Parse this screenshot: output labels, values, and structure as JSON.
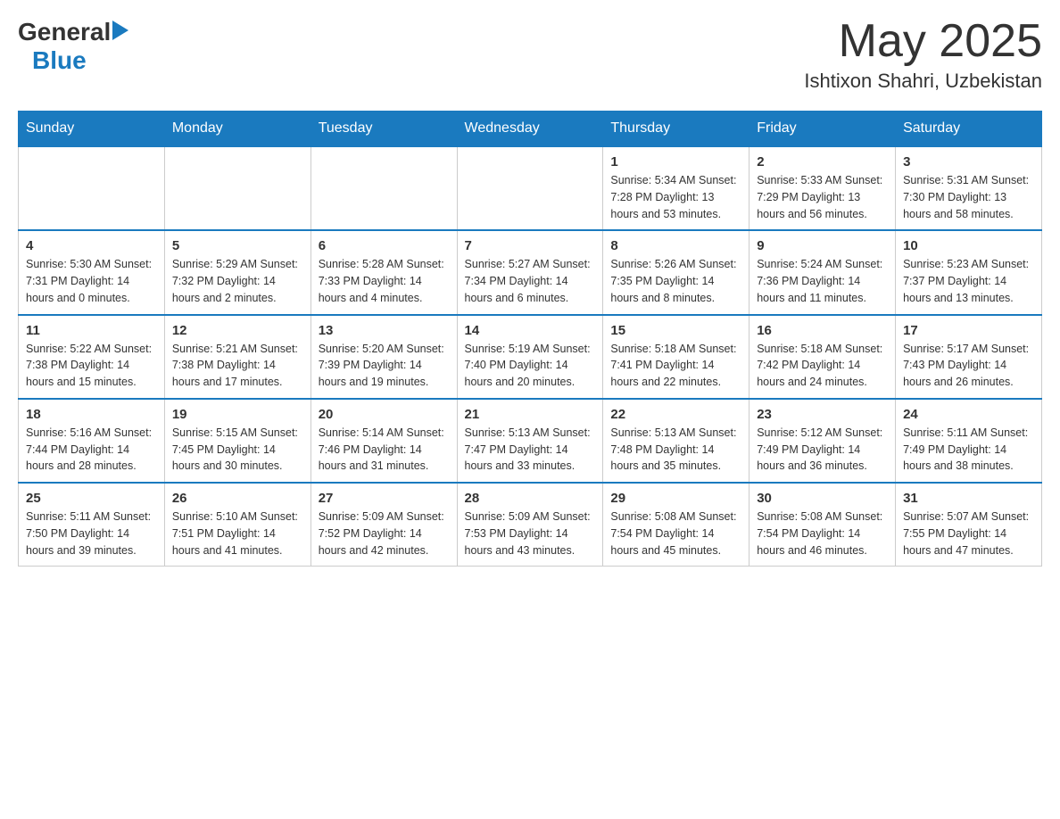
{
  "logo": {
    "general": "General",
    "blue": "Blue",
    "triangle": "▶"
  },
  "title": {
    "month": "May 2025",
    "location": "Ishtixon Shahri, Uzbekistan"
  },
  "weekdays": [
    "Sunday",
    "Monday",
    "Tuesday",
    "Wednesday",
    "Thursday",
    "Friday",
    "Saturday"
  ],
  "weeks": [
    [
      {
        "day": "",
        "info": ""
      },
      {
        "day": "",
        "info": ""
      },
      {
        "day": "",
        "info": ""
      },
      {
        "day": "",
        "info": ""
      },
      {
        "day": "1",
        "info": "Sunrise: 5:34 AM\nSunset: 7:28 PM\nDaylight: 13 hours\nand 53 minutes."
      },
      {
        "day": "2",
        "info": "Sunrise: 5:33 AM\nSunset: 7:29 PM\nDaylight: 13 hours\nand 56 minutes."
      },
      {
        "day": "3",
        "info": "Sunrise: 5:31 AM\nSunset: 7:30 PM\nDaylight: 13 hours\nand 58 minutes."
      }
    ],
    [
      {
        "day": "4",
        "info": "Sunrise: 5:30 AM\nSunset: 7:31 PM\nDaylight: 14 hours\nand 0 minutes."
      },
      {
        "day": "5",
        "info": "Sunrise: 5:29 AM\nSunset: 7:32 PM\nDaylight: 14 hours\nand 2 minutes."
      },
      {
        "day": "6",
        "info": "Sunrise: 5:28 AM\nSunset: 7:33 PM\nDaylight: 14 hours\nand 4 minutes."
      },
      {
        "day": "7",
        "info": "Sunrise: 5:27 AM\nSunset: 7:34 PM\nDaylight: 14 hours\nand 6 minutes."
      },
      {
        "day": "8",
        "info": "Sunrise: 5:26 AM\nSunset: 7:35 PM\nDaylight: 14 hours\nand 8 minutes."
      },
      {
        "day": "9",
        "info": "Sunrise: 5:24 AM\nSunset: 7:36 PM\nDaylight: 14 hours\nand 11 minutes."
      },
      {
        "day": "10",
        "info": "Sunrise: 5:23 AM\nSunset: 7:37 PM\nDaylight: 14 hours\nand 13 minutes."
      }
    ],
    [
      {
        "day": "11",
        "info": "Sunrise: 5:22 AM\nSunset: 7:38 PM\nDaylight: 14 hours\nand 15 minutes."
      },
      {
        "day": "12",
        "info": "Sunrise: 5:21 AM\nSunset: 7:38 PM\nDaylight: 14 hours\nand 17 minutes."
      },
      {
        "day": "13",
        "info": "Sunrise: 5:20 AM\nSunset: 7:39 PM\nDaylight: 14 hours\nand 19 minutes."
      },
      {
        "day": "14",
        "info": "Sunrise: 5:19 AM\nSunset: 7:40 PM\nDaylight: 14 hours\nand 20 minutes."
      },
      {
        "day": "15",
        "info": "Sunrise: 5:18 AM\nSunset: 7:41 PM\nDaylight: 14 hours\nand 22 minutes."
      },
      {
        "day": "16",
        "info": "Sunrise: 5:18 AM\nSunset: 7:42 PM\nDaylight: 14 hours\nand 24 minutes."
      },
      {
        "day": "17",
        "info": "Sunrise: 5:17 AM\nSunset: 7:43 PM\nDaylight: 14 hours\nand 26 minutes."
      }
    ],
    [
      {
        "day": "18",
        "info": "Sunrise: 5:16 AM\nSunset: 7:44 PM\nDaylight: 14 hours\nand 28 minutes."
      },
      {
        "day": "19",
        "info": "Sunrise: 5:15 AM\nSunset: 7:45 PM\nDaylight: 14 hours\nand 30 minutes."
      },
      {
        "day": "20",
        "info": "Sunrise: 5:14 AM\nSunset: 7:46 PM\nDaylight: 14 hours\nand 31 minutes."
      },
      {
        "day": "21",
        "info": "Sunrise: 5:13 AM\nSunset: 7:47 PM\nDaylight: 14 hours\nand 33 minutes."
      },
      {
        "day": "22",
        "info": "Sunrise: 5:13 AM\nSunset: 7:48 PM\nDaylight: 14 hours\nand 35 minutes."
      },
      {
        "day": "23",
        "info": "Sunrise: 5:12 AM\nSunset: 7:49 PM\nDaylight: 14 hours\nand 36 minutes."
      },
      {
        "day": "24",
        "info": "Sunrise: 5:11 AM\nSunset: 7:49 PM\nDaylight: 14 hours\nand 38 minutes."
      }
    ],
    [
      {
        "day": "25",
        "info": "Sunrise: 5:11 AM\nSunset: 7:50 PM\nDaylight: 14 hours\nand 39 minutes."
      },
      {
        "day": "26",
        "info": "Sunrise: 5:10 AM\nSunset: 7:51 PM\nDaylight: 14 hours\nand 41 minutes."
      },
      {
        "day": "27",
        "info": "Sunrise: 5:09 AM\nSunset: 7:52 PM\nDaylight: 14 hours\nand 42 minutes."
      },
      {
        "day": "28",
        "info": "Sunrise: 5:09 AM\nSunset: 7:53 PM\nDaylight: 14 hours\nand 43 minutes."
      },
      {
        "day": "29",
        "info": "Sunrise: 5:08 AM\nSunset: 7:54 PM\nDaylight: 14 hours\nand 45 minutes."
      },
      {
        "day": "30",
        "info": "Sunrise: 5:08 AM\nSunset: 7:54 PM\nDaylight: 14 hours\nand 46 minutes."
      },
      {
        "day": "31",
        "info": "Sunrise: 5:07 AM\nSunset: 7:55 PM\nDaylight: 14 hours\nand 47 minutes."
      }
    ]
  ]
}
